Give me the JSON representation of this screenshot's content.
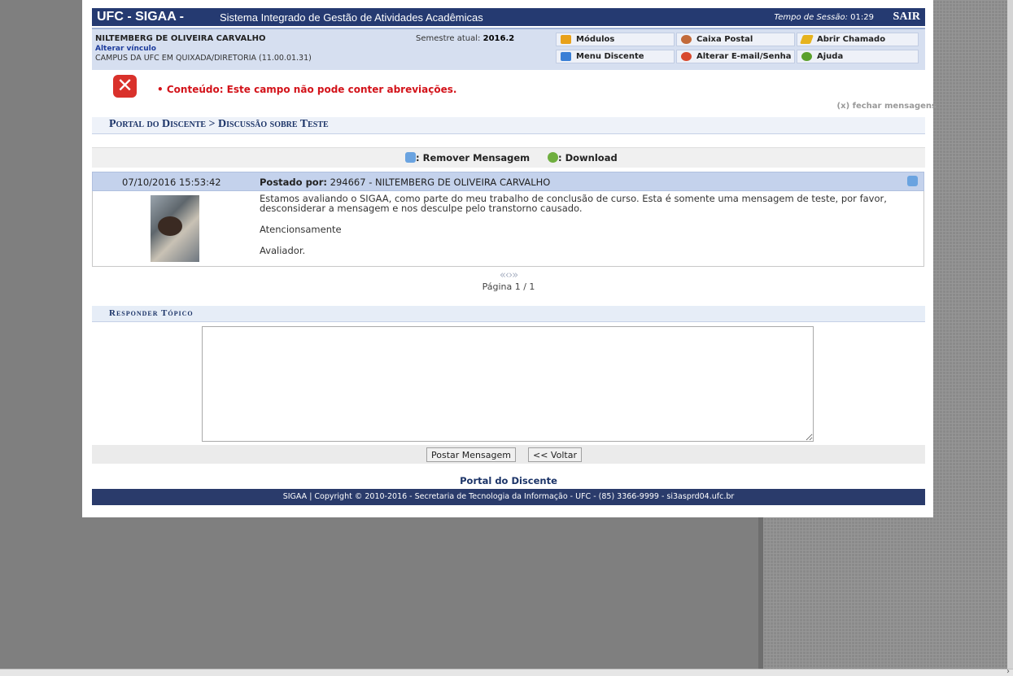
{
  "header": {
    "logo": "UFC - SIGAA -",
    "system_name": "Sistema Integrado de Gestão de Atividades Acadêmicas",
    "session_label": "Tempo de Sessão:",
    "session_time": "01:29",
    "logout": "SAIR"
  },
  "user": {
    "name": "NILTEMBERG DE OLIVEIRA CARVALHO",
    "change_link": "Alterar vínculo",
    "campus": "CAMPUS DA UFC EM QUIXADA/DIRETORIA (11.00.01.31)",
    "semester_label": "Semestre atual:",
    "semester": "2016.2"
  },
  "menu": {
    "modulos": "Módulos",
    "caixa_postal": "Caixa Postal",
    "abrir_chamado": "Abrir Chamado",
    "menu_discente": "Menu Discente",
    "alterar_email": "Alterar E-mail/Senha",
    "ajuda": "Ajuda"
  },
  "messages": {
    "error": "Conteúdo: Este campo não pode conter abreviações.",
    "close": "(x) fechar mensagens"
  },
  "breadcrumb": "Portal do Discente > Discussão sobre Teste",
  "actions": {
    "remove": ": Remover Mensagem",
    "download": ": Download"
  },
  "post": {
    "datetime": "07/10/2016 15:53:42",
    "posted_by_label": "Postado por:",
    "author": "294667 - NILTEMBERG DE OLIVEIRA CARVALHO",
    "paragraphs": [
      "Estamos avaliando o SIGAA, como parte do meu trabalho de conclusão de curso. Esta é somente uma mensagem de teste, por favor, desconsiderar a mensagem e nos desculpe pelo transtorno causado.",
      "Atencionsamente",
      "Avaliador."
    ]
  },
  "pager": {
    "arrows": "«‹›»",
    "label": "Página 1 / 1"
  },
  "reply": {
    "title": "Responder Tópico",
    "textarea_value": "",
    "submit": "Postar Mensagem",
    "back": "<< Voltar"
  },
  "footer": {
    "portal_link": "Portal do Discente",
    "copyright": "SIGAA | Copyright © 2010-2016 - Secretaria de Tecnologia da Informação - UFC - (85) 3366-9999 - si3asprd04.ufc.br"
  },
  "colors": {
    "topbar": "#253a71",
    "error_red": "#d3131a",
    "post_header": "#c4d2ec"
  },
  "icons": [
    "close-error-icon",
    "modulos-icon",
    "caixa-postal-icon",
    "abrir-chamado-icon",
    "menu-discente-icon",
    "alterar-email-icon",
    "ajuda-icon",
    "remove-message-icon",
    "download-icon"
  ]
}
